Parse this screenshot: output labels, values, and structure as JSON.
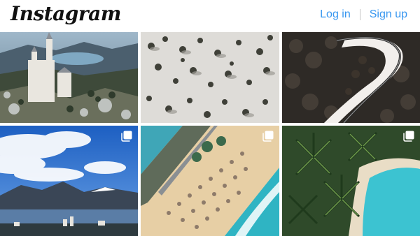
{
  "header": {
    "logo": "Instagram",
    "login_label": "Log in",
    "signup_label": "Sign up"
  },
  "colors": {
    "link": "#3897f0",
    "logo": "#111111",
    "background": "#ffffff"
  },
  "grid": {
    "posts": [
      {
        "subject": "castle-on-hill",
        "multi_image": false
      },
      {
        "subject": "snowy-forest-aerial",
        "multi_image": false
      },
      {
        "subject": "winding-road-forest",
        "multi_image": false
      },
      {
        "subject": "lake-mountains-town",
        "multi_image": true
      },
      {
        "subject": "beach-umbrellas-aerial",
        "multi_image": true
      },
      {
        "subject": "palm-trees-beach",
        "multi_image": true
      }
    ],
    "multi_icon": "carousel-icon"
  }
}
